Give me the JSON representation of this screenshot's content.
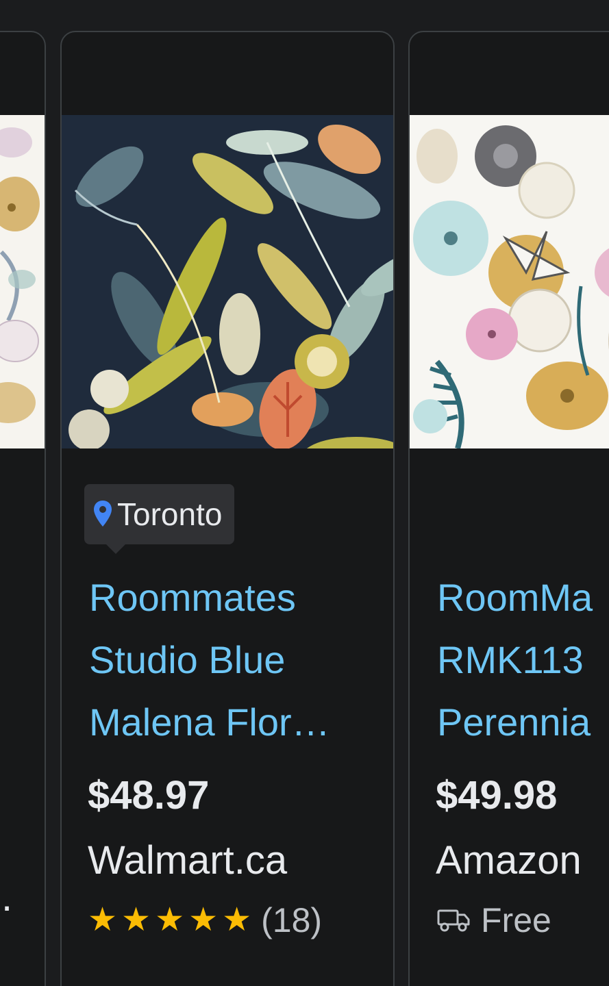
{
  "cards": [
    {
      "seller_partial": "."
    },
    {
      "location": "Toronto",
      "title_lines": [
        "Roommates",
        "Studio Blue",
        "Malena Flor…"
      ],
      "price": "$48.97",
      "seller": "Walmart.ca",
      "rating_stars": 5,
      "rating_count": "(18)"
    },
    {
      "title_lines": [
        "RoomMa",
        "RMK113",
        "Perennia"
      ],
      "price": "$49.98",
      "seller": "Amazon",
      "shipping": "Free"
    }
  ],
  "icons": {
    "location": "location-pin-icon",
    "star": "star-icon",
    "shipping": "delivery-truck-icon"
  },
  "colors": {
    "background": "#1b1c1e",
    "card_border": "#3c4043",
    "title_link": "#6ec6f5",
    "star": "#fbbc04",
    "pin": "#4285f4"
  }
}
